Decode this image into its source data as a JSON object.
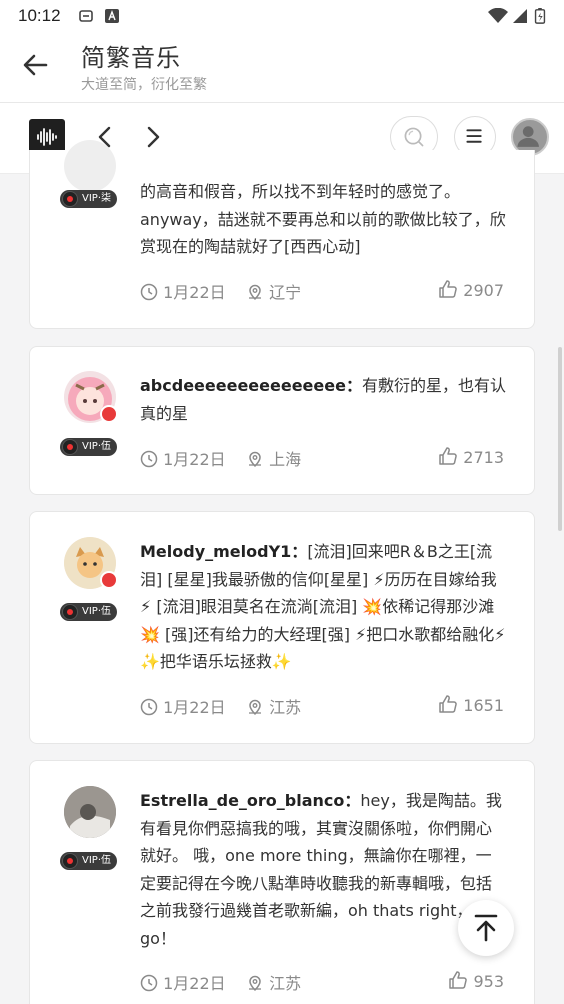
{
  "status_bar": {
    "time": "10:12"
  },
  "app_bar": {
    "title": "简繁音乐",
    "subtitle": "大道至简，衍化至繁"
  },
  "toolbar": {
    "logo_icon": "waveform-icon",
    "back_icon": "chevron-left-icon",
    "forward_icon": "chevron-right-icon",
    "search_icon": "search-icon",
    "menu_icon": "menu-icon",
    "avatar_icon": "user-avatar-icon"
  },
  "comments": [
    {
      "vip": "VIP·柒",
      "name": "",
      "text": "的高音和假音，所以找不到年轻时的感觉了。anyway，喆迷就不要再总和以前的歌做比较了，欣赏现在的陶喆就好了[西西心动]",
      "date": "1月22日",
      "location": "辽宁",
      "likes": "2907"
    },
    {
      "vip": "VIP·伍",
      "name": "abcdeeeeeeeeeeeeeee：",
      "text": "有敷衍的星，也有认真的星",
      "date": "1月22日",
      "location": "上海",
      "likes": "2713"
    },
    {
      "vip": "VIP·伍",
      "name": "Melody_melodY1：",
      "text": "[流泪]回来吧R＆B之王[流泪] [星星]我最骄傲的信仰[星星] ⚡历历在目嫁给我⚡ [流泪]眼泪莫名在流淌[流泪] 💥依稀记得那沙滩💥 [强]还有给力的大经理[强] ⚡把口水歌都给融化⚡ ✨把华语乐坛拯救✨",
      "date": "1月22日",
      "location": "江苏",
      "likes": "1651"
    },
    {
      "vip": "VIP·伍",
      "name": "Estrella_de_oro_blanco：",
      "text": "hey，我是陶喆。我有看見你們惡搞我的哦，其實沒關係啦，你們開心就好。 哦，one more thing，無論你在哪裡，一定要記得在今晚八點準時收聽我的新專輯哦，包括之前我發行過幾首老歌新編，oh thats right，lets go！",
      "date": "1月22日",
      "location": "江苏",
      "likes": "953"
    }
  ],
  "colors": {
    "accent": "#e83a3a",
    "muted": "#8a8a8a"
  }
}
